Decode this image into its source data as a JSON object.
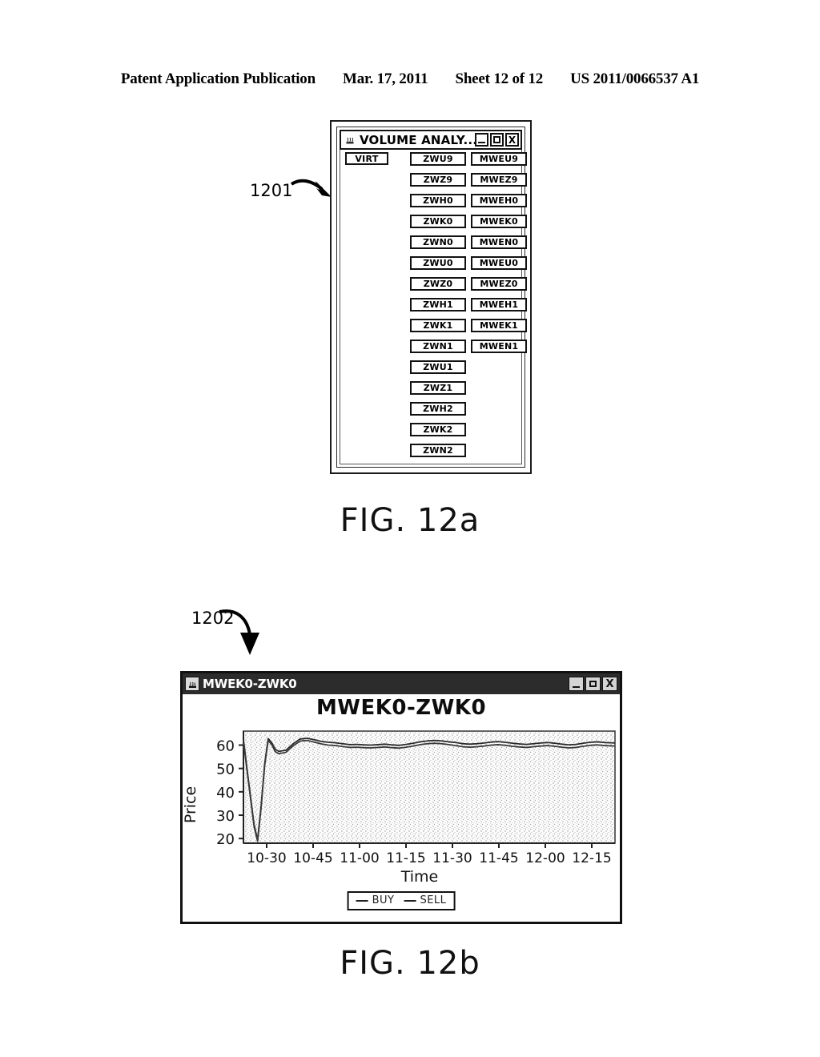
{
  "header": {
    "publication": "Patent Application Publication",
    "date": "Mar. 17, 2011",
    "sheet": "Sheet 12 of 12",
    "patent_number": "US 2011/0066537 A1"
  },
  "figures": {
    "fig_a_caption": "FIG. 12a",
    "fig_b_caption": "FIG. 12b",
    "callout_a": "1201",
    "callout_b": "1202"
  },
  "volume_window": {
    "title": "VOLUME ANALY...",
    "icon": "app-icon",
    "controls": {
      "minimize": "minimize-icon",
      "maximize": "maximize-icon",
      "close": "X"
    },
    "virt_button": "VIRT",
    "zw_contracts": [
      "ZWU9",
      "ZWZ9",
      "ZWH0",
      "ZWK0",
      "ZWN0",
      "ZWU0",
      "ZWZ0",
      "ZWH1",
      "ZWK1",
      "ZWN1",
      "ZWU1",
      "ZWZ1",
      "ZWH2",
      "ZWK2",
      "ZWN2"
    ],
    "mwe_contracts": [
      "MWEU9",
      "MWEZ9",
      "MWEH0",
      "MWEK0",
      "MWEN0",
      "MWEU0",
      "MWEZ0",
      "MWEH1",
      "MWEK1",
      "MWEN1"
    ]
  },
  "chart_window": {
    "titlebar_title": "MWEK0-ZWK0",
    "icon": "java-cup-icon",
    "controls": {
      "minimize": "minimize-icon",
      "maximize": "maximize-icon",
      "close": "X"
    }
  },
  "chart_data": {
    "type": "line",
    "title": "MWEK0-ZWK0",
    "xlabel": "Time",
    "ylabel": "Price",
    "xticks": [
      "10-30",
      "10-45",
      "11-00",
      "11-15",
      "11-30",
      "11-45",
      "12-00",
      "12-15"
    ],
    "yticks": [
      20,
      30,
      40,
      50,
      60
    ],
    "ylim": [
      18,
      66
    ],
    "xlim": [
      0,
      105
    ],
    "grid": false,
    "legend_position": "bottom-center",
    "legend": [
      "BUY",
      "SELL"
    ],
    "series": [
      {
        "name": "BUY",
        "color": "#2a2a2a",
        "x": [
          0,
          1,
          2,
          3,
          4,
          5,
          6,
          7,
          8,
          9,
          10,
          12,
          14,
          16,
          18,
          20,
          22,
          24,
          26,
          28,
          30,
          32,
          34,
          36,
          38,
          40,
          42,
          44,
          46,
          48,
          50,
          52,
          54,
          56,
          58,
          60,
          62,
          64,
          66,
          68,
          70,
          72,
          74,
          76,
          78,
          80,
          82,
          84,
          86,
          88,
          90,
          92,
          94,
          96,
          98,
          100,
          102,
          105
        ],
        "y": [
          62.5,
          50.0,
          38.0,
          26.0,
          19.5,
          34.0,
          52.0,
          62.8,
          61.0,
          58.2,
          57.3,
          57.8,
          60.5,
          62.6,
          62.9,
          62.3,
          61.6,
          61.2,
          61.0,
          60.6,
          60.2,
          60.3,
          60.1,
          60.0,
          60.2,
          60.4,
          60.1,
          59.9,
          60.3,
          60.8,
          61.4,
          61.8,
          62.0,
          61.8,
          61.4,
          61.1,
          60.6,
          60.4,
          60.6,
          60.9,
          61.3,
          61.5,
          61.2,
          60.8,
          60.5,
          60.3,
          60.6,
          60.9,
          61.1,
          60.8,
          60.4,
          60.1,
          60.3,
          60.8,
          61.2,
          61.4,
          61.1,
          60.9
        ]
      },
      {
        "name": "SELL",
        "color": "#3a3a3a",
        "x": [
          0,
          1,
          2,
          3,
          4,
          5,
          6,
          7,
          8,
          9,
          10,
          12,
          14,
          16,
          18,
          20,
          22,
          24,
          26,
          28,
          30,
          32,
          34,
          36,
          38,
          40,
          42,
          44,
          46,
          48,
          50,
          52,
          54,
          56,
          58,
          60,
          62,
          64,
          66,
          68,
          70,
          72,
          74,
          76,
          78,
          80,
          82,
          84,
          86,
          88,
          90,
          92,
          94,
          96,
          98,
          100,
          102,
          105
        ],
        "y": [
          61.8,
          49.3,
          37.2,
          25.2,
          18.8,
          33.2,
          51.2,
          62.0,
          60.2,
          57.2,
          56.3,
          56.9,
          59.6,
          61.7,
          62.0,
          61.3,
          60.5,
          60.0,
          59.8,
          59.4,
          59.0,
          59.1,
          58.9,
          58.8,
          59.0,
          59.2,
          58.9,
          58.7,
          59.1,
          59.6,
          60.2,
          60.6,
          60.8,
          60.6,
          60.2,
          59.8,
          59.3,
          59.1,
          59.3,
          59.6,
          60.0,
          60.2,
          59.9,
          59.5,
          59.2,
          59.0,
          59.3,
          59.6,
          59.8,
          59.5,
          59.1,
          58.8,
          59.0,
          59.5,
          59.9,
          60.1,
          59.8,
          59.6
        ]
      }
    ]
  }
}
